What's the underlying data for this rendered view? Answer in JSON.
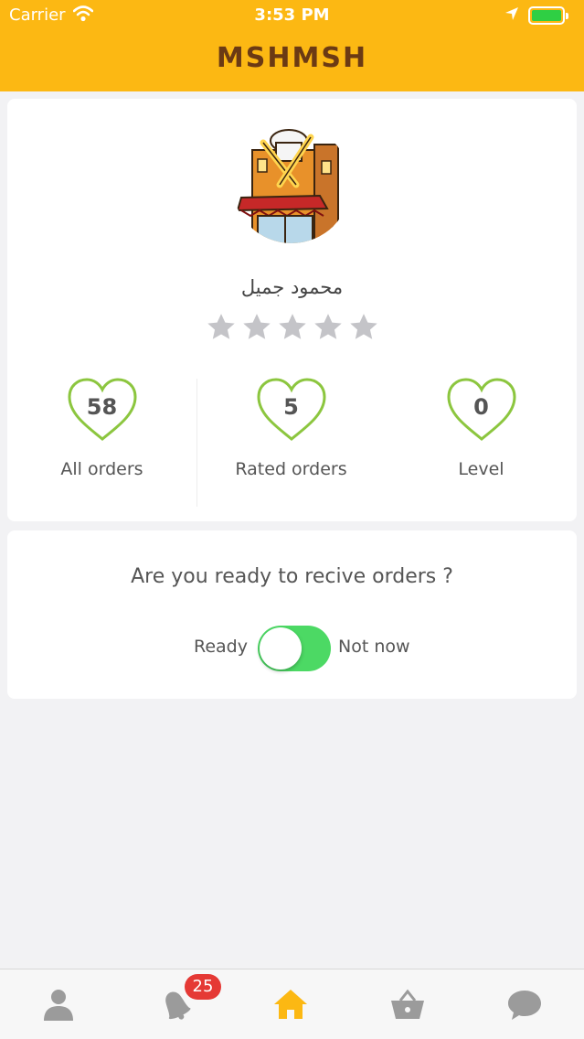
{
  "status_bar": {
    "carrier": "Carrier",
    "time": "3:53 PM"
  },
  "header": {
    "title": "MSHMSH"
  },
  "profile": {
    "name": "محمود جميل",
    "rating": 0,
    "max_rating": 5
  },
  "stats": [
    {
      "value": "58",
      "label": "All orders"
    },
    {
      "value": "5",
      "label": "Rated orders"
    },
    {
      "value": "0",
      "label": "Level"
    }
  ],
  "ready_card": {
    "question": "Are you ready to recive orders ?",
    "ready_label": "Ready",
    "not_now_label": "Not now",
    "toggle_on": true
  },
  "tabbar": {
    "items": [
      {
        "icon": "person-icon"
      },
      {
        "icon": "bell-icon",
        "badge": "25"
      },
      {
        "icon": "home-icon",
        "active": true
      },
      {
        "icon": "basket-icon"
      },
      {
        "icon": "chat-icon"
      }
    ]
  },
  "colors": {
    "header_bg": "#fcb813",
    "title_color": "#6b3a14",
    "heart_stroke": "#8cc63f",
    "toggle_on": "#4cd964",
    "badge": "#e53935",
    "tab_active": "#fcb813",
    "tab_inactive": "#9b9b9b"
  }
}
